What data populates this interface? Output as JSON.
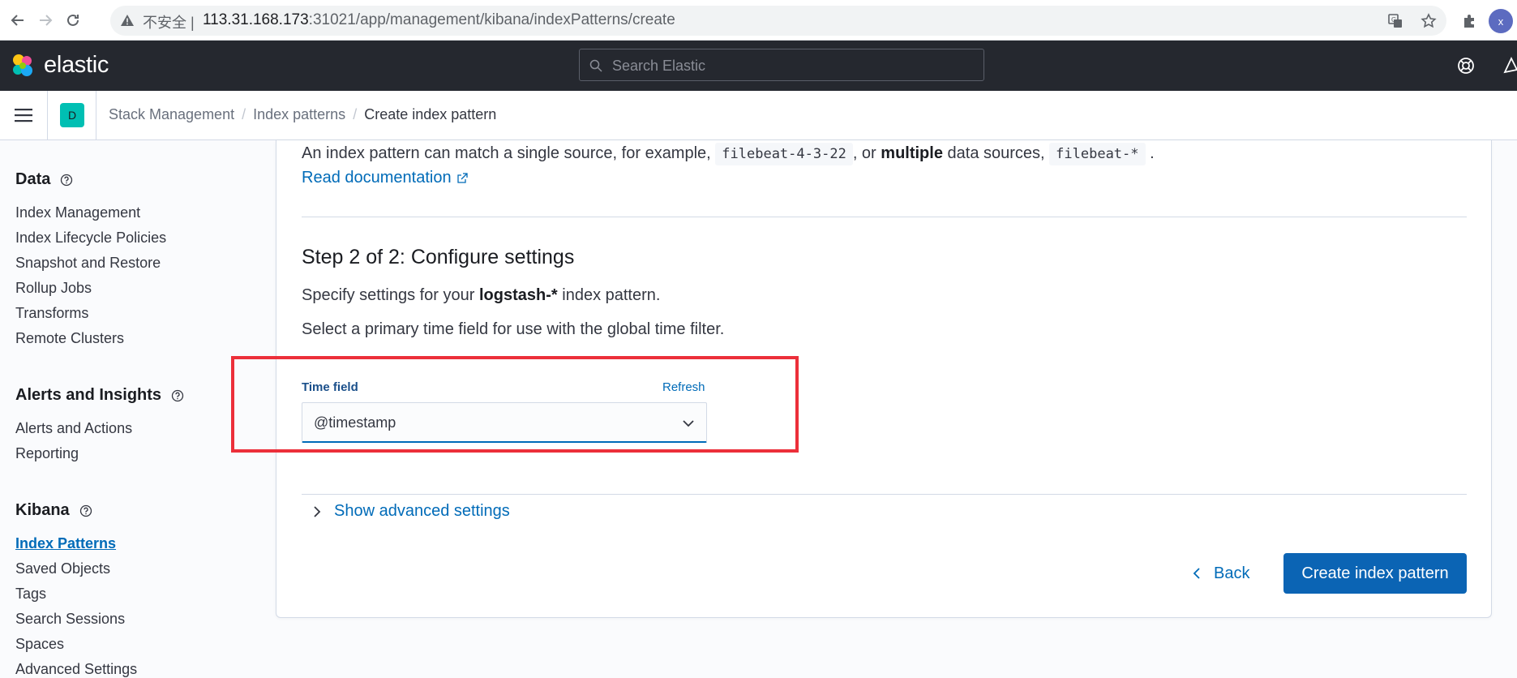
{
  "browser": {
    "insecure_label": "不安全",
    "url_host": "113.31.168.173",
    "url_rest": ":31021/app/management/kibana/indexPatterns/create",
    "profile_initial": "x"
  },
  "header": {
    "logo_text": "elastic",
    "search_placeholder": "Search Elastic"
  },
  "breadcrumb": {
    "space_initial": "D",
    "items": [
      "Stack Management",
      "Index patterns"
    ],
    "current": "Create index pattern"
  },
  "sidebar": {
    "sections": [
      {
        "title": "Data",
        "items": [
          "Index Management",
          "Index Lifecycle Policies",
          "Snapshot and Restore",
          "Rollup Jobs",
          "Transforms",
          "Remote Clusters"
        ]
      },
      {
        "title": "Alerts and Insights",
        "items": [
          "Alerts and Actions",
          "Reporting"
        ]
      },
      {
        "title": "Kibana",
        "items": [
          "Index Patterns",
          "Saved Objects",
          "Tags",
          "Search Sessions",
          "Spaces",
          "Advanced Settings"
        ]
      }
    ],
    "active_item": "Index Patterns"
  },
  "main": {
    "intro_prefix": "An index pattern can match a single source, for example,",
    "intro_code1": "filebeat-4-3-22",
    "intro_mid1": ", or",
    "intro_bold": "multiple",
    "intro_mid2": "data sources,",
    "intro_code2": "filebeat-*",
    "intro_end": ".",
    "read_docs": "Read documentation",
    "step_title": "Step 2 of 2: Configure settings",
    "specify_prefix": "Specify settings for your",
    "specify_pattern": "logstash-*",
    "specify_suffix": "index pattern.",
    "time_instruction": "Select a primary time field for use with the global time filter.",
    "time_field_label": "Time field",
    "refresh_label": "Refresh",
    "time_field_value": "@timestamp",
    "advanced_label": "Show advanced settings",
    "back_label": "Back",
    "create_label": "Create index pattern"
  },
  "colors": {
    "link": "#006bb8",
    "primary_button": "#0b64b4",
    "header_bg": "#25282f",
    "highlight": "#ec2f3a",
    "space_avatar": "#00bfb3"
  },
  "icons": [
    "back-arrow-icon",
    "forward-arrow-icon",
    "reload-icon",
    "warning-icon",
    "translate-icon",
    "star-icon",
    "extensions-icon",
    "elastic-logo-icon",
    "search-icon",
    "help-icon",
    "newsfeed-icon",
    "menu-icon",
    "external-link-icon",
    "chevron-down-icon",
    "chevron-right-icon",
    "chevron-left-icon"
  ]
}
